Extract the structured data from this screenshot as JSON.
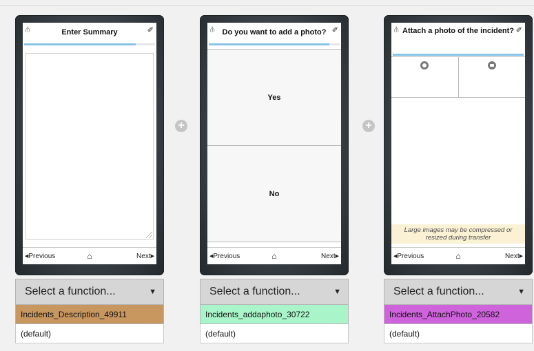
{
  "common": {
    "footer": {
      "previous": "Previous",
      "next": "Next"
    },
    "select_placeholder": "Select a function...",
    "default_label": "(default)"
  },
  "cards": [
    {
      "title": "Enter Summary",
      "progress": 0.85,
      "function_name": "Incidents_Description_49911",
      "function_color": "#c8965f"
    },
    {
      "title": "Do you want to add a photo?",
      "progress": 0.92,
      "options": [
        "Yes",
        "No"
      ],
      "function_name": "Incidents_addaphoto_30722",
      "function_color": "#a9f5c9"
    },
    {
      "title": "Attach a photo of the incident?",
      "progress": 1.0,
      "photo_buttons": [
        "camera-icon",
        "folder-icon"
      ],
      "warning": "Large images may be compressed or resized during transfer",
      "function_name": "Incidents_AttachPhoto_20582",
      "function_color": "#cf63dc"
    }
  ],
  "colors": {
    "progress": "#86c3e6",
    "warning_bg": "#fbf1d4",
    "background": "#f1f1f1"
  }
}
